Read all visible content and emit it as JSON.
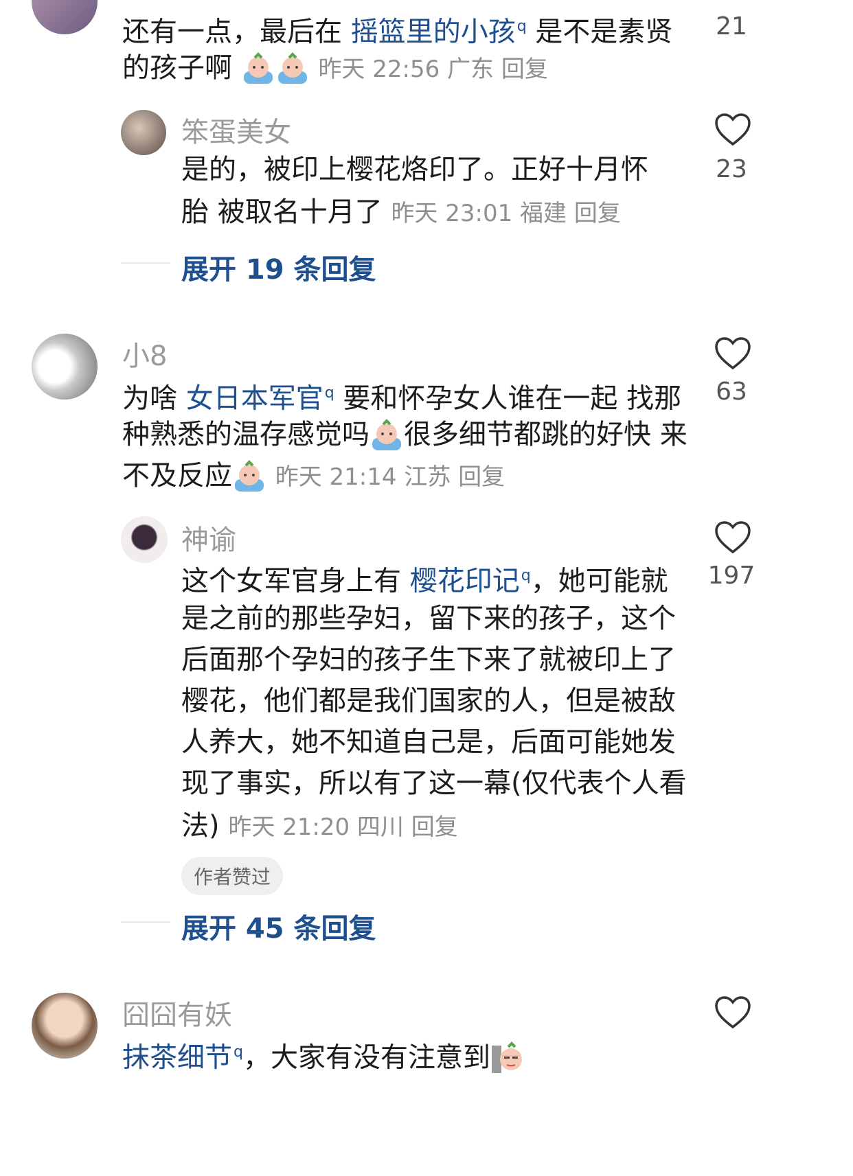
{
  "comments": [
    {
      "lines": [
        [
          {
            "t": "还有一点，最后在 "
          },
          {
            "t": "摇篮里的小孩",
            "link": true
          },
          {
            "t": " 是不是素贤"
          }
        ],
        [
          {
            "t": "的孩子啊"
          }
        ]
      ],
      "meta": "昨天 22:56 广东 回复",
      "likes": "21"
    },
    {
      "user": "笨蛋美女",
      "lines": [
        "是的，被印上樱花烙印了。正好十月怀",
        "胎 被取名十月了"
      ],
      "meta": "昨天 23:01 福建 回复",
      "likes": "23"
    },
    {
      "expand": "展开 19 条回复"
    },
    {
      "user": "小8",
      "lines": [
        [
          {
            "t": "为啥 "
          },
          {
            "t": "女日本军官",
            "link": true
          },
          {
            "t": " 要和怀孕女人谁在一起 找那"
          }
        ],
        [
          {
            "t": "种熟悉的温存感觉吗"
          },
          {
            "t": "很多细节都跳的好快 来"
          }
        ],
        [
          {
            "t": "不及反应"
          }
        ]
      ],
      "meta": "昨天 21:14 江苏 回复",
      "likes": "63"
    },
    {
      "user": "神谕",
      "lines": [
        [
          {
            "t": "这个女军官身上有 "
          },
          {
            "t": "樱花印记",
            "link": true
          },
          {
            "t": "，她可能就"
          }
        ],
        [
          {
            "t": "是之前的那些孕妇，留下来的孩子，这个"
          }
        ],
        [
          {
            "t": "后面那个孕妇的孩子生下来了就被印上了"
          }
        ],
        [
          {
            "t": "樱花，他们都是我们国家的人，但是被敌"
          }
        ],
        [
          {
            "t": "人养大，她不知道自己是，后面可能她发"
          }
        ],
        [
          {
            "t": "现了事实，所以有了这一幕(仅代表个人看"
          }
        ],
        [
          {
            "t": "法)"
          }
        ]
      ],
      "meta": "昨天 21:20 四川 回复",
      "badge": "作者赞过",
      "likes": "197"
    },
    {
      "expand": "展开 45 条回复"
    },
    {
      "user": "囧囧有妖",
      "lines": [
        [
          {
            "t": "抹茶细节",
            "link": true
          },
          {
            "t": "，大家有没有注意到"
          }
        ]
      ]
    }
  ],
  "icons": {
    "like": "heart-outline-icon",
    "search_hint": "search-q-icon",
    "emoji": "crying-emoji-icon"
  }
}
